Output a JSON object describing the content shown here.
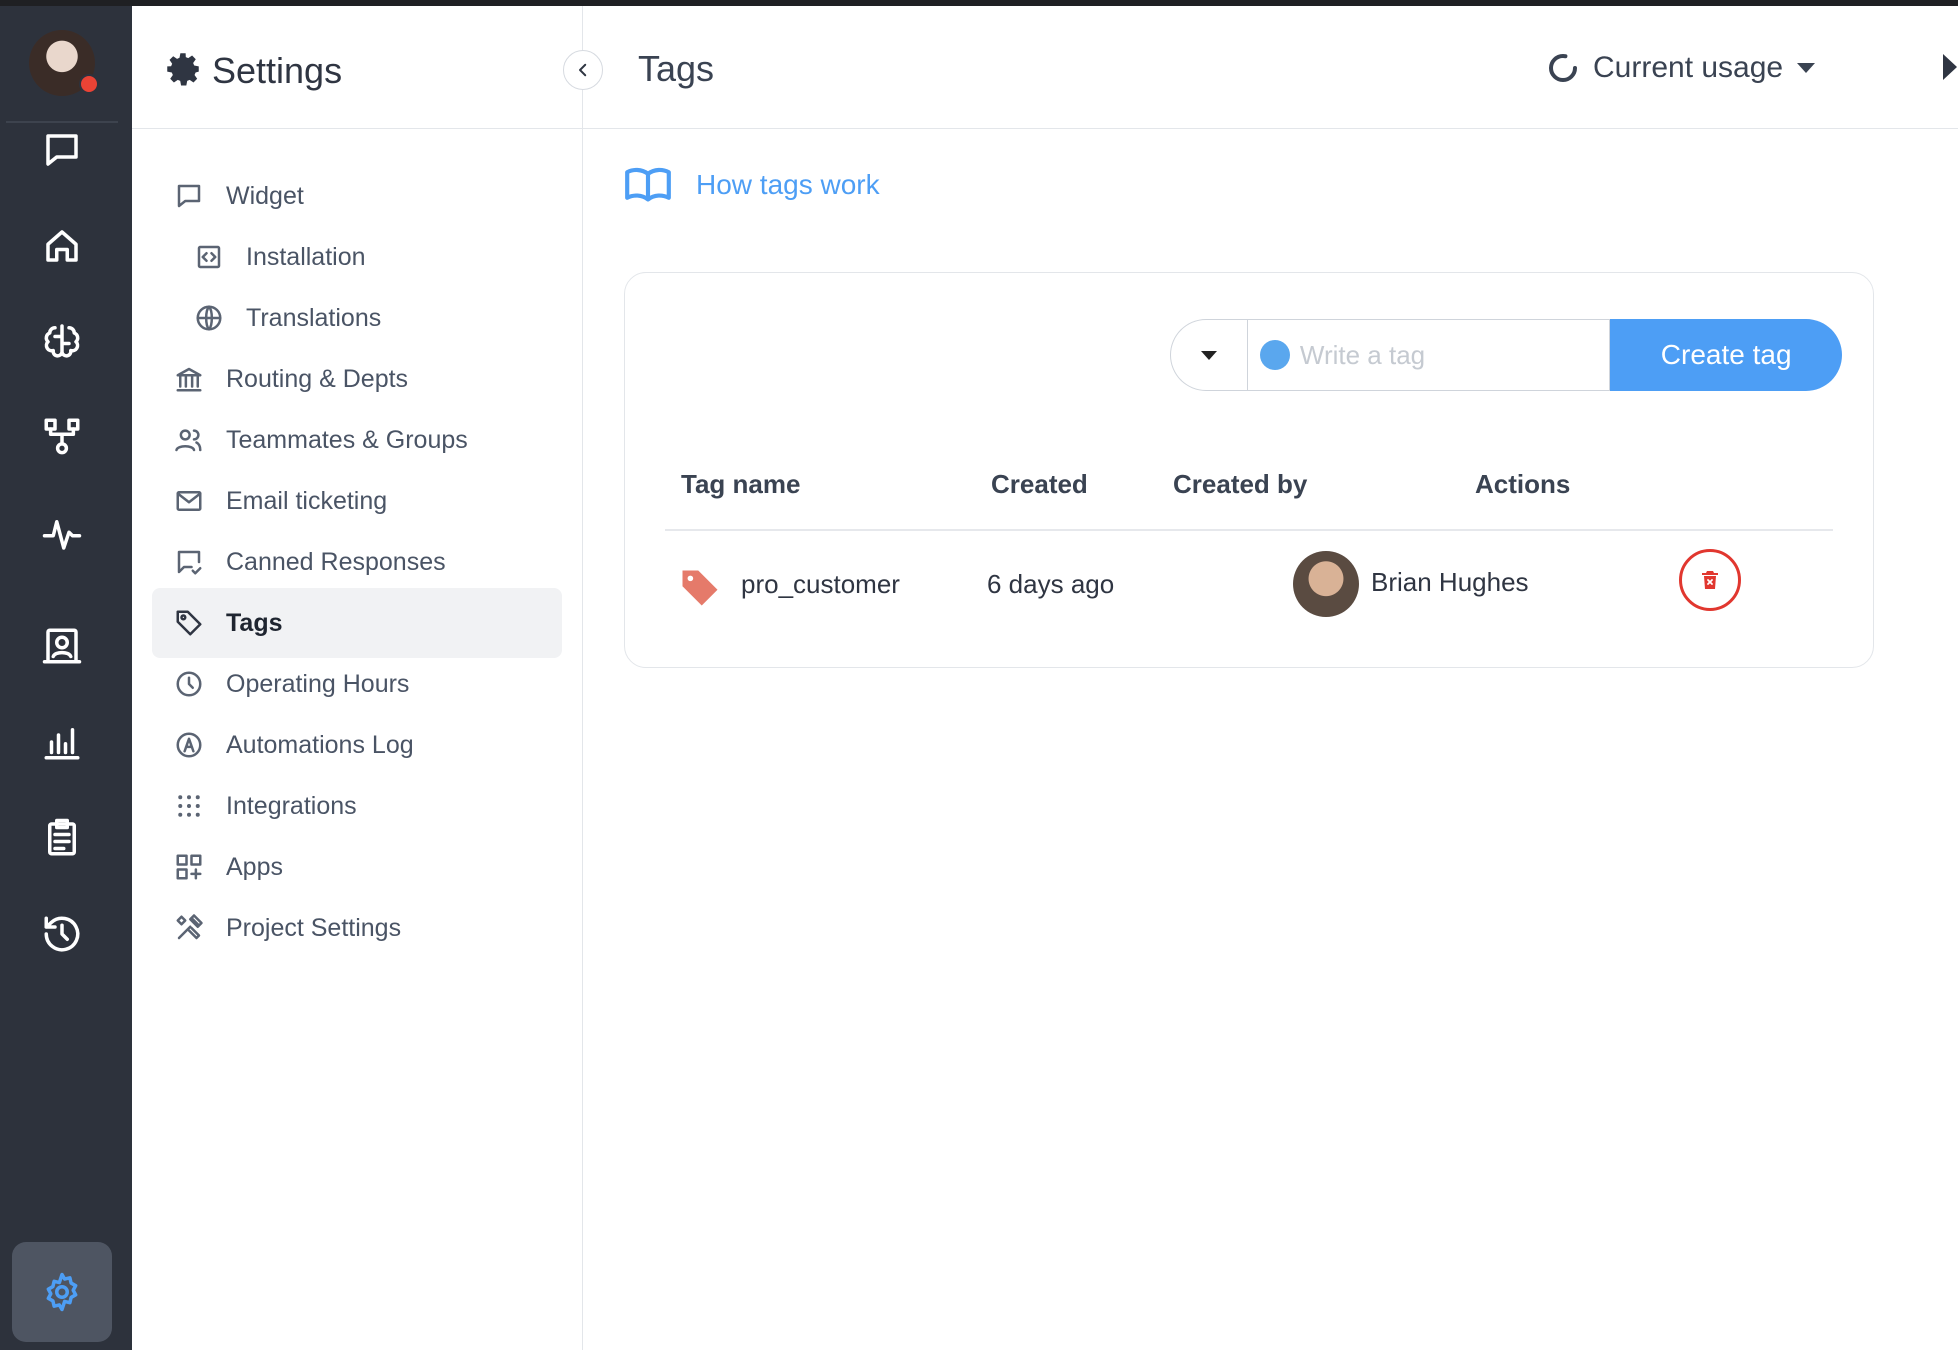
{
  "rail": {
    "icons": [
      "chat-icon",
      "home-icon",
      "brain-icon",
      "flow-icon",
      "pulse-icon",
      "contact-card-icon",
      "bar-chart-icon",
      "clipboard-icon",
      "history-icon",
      "gear-icon"
    ],
    "active": "gear-icon",
    "accent": "#4d9ef5",
    "presence_color": "#ea4335"
  },
  "sidebar": {
    "title": "Settings",
    "items": [
      {
        "label": "Widget",
        "icon": "chat-square-icon"
      },
      {
        "label": "Installation",
        "icon": "code-icon"
      },
      {
        "label": "Translations",
        "icon": "globe-icon"
      },
      {
        "label": "Routing & Depts",
        "icon": "bank-icon"
      },
      {
        "label": "Teammates & Groups",
        "icon": "users-icon"
      },
      {
        "label": "Email ticketing",
        "icon": "mail-icon"
      },
      {
        "label": "Canned Responses",
        "icon": "canned-response-icon"
      },
      {
        "label": "Tags",
        "icon": "tag-icon",
        "active": true
      },
      {
        "label": "Operating Hours",
        "icon": "clock-icon"
      },
      {
        "label": "Automations Log",
        "icon": "automation-icon"
      },
      {
        "label": "Integrations",
        "icon": "grid-dots-icon"
      },
      {
        "label": "Apps",
        "icon": "apps-icon"
      },
      {
        "label": "Project Settings",
        "icon": "tools-icon"
      }
    ]
  },
  "header": {
    "title": "Tags",
    "usage_label": "Current usage"
  },
  "main": {
    "help_link": "How tags work",
    "form": {
      "placeholder": "Write a tag",
      "create_label": "Create tag",
      "dot_color": "#5aa7ee"
    },
    "table": {
      "columns": [
        "Tag name",
        "Created",
        "Created by",
        "Actions"
      ],
      "rows": [
        {
          "tag": "pro_customer",
          "created": "6 days ago",
          "created_by": "Brian Hughes",
          "tag_color": "#e57a6a"
        }
      ]
    },
    "delete_color": "#e1372f"
  }
}
